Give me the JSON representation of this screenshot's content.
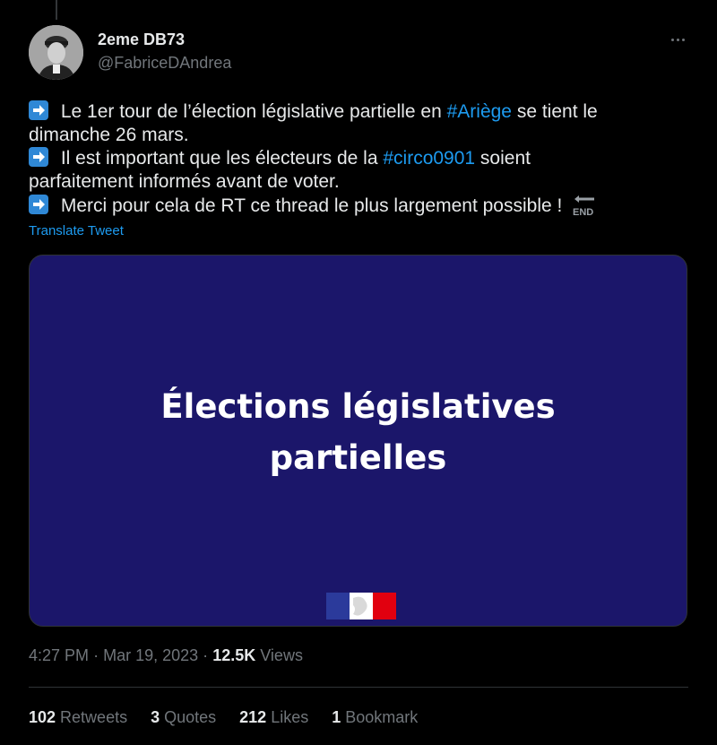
{
  "author": {
    "display_name": "2eme DB73",
    "handle": "@FabriceDAndrea"
  },
  "tweet": {
    "line1_a": " Le 1er tour de l’élection législative partielle en ",
    "line1_hashtag": "#Ariège",
    "line1_b": " se tient le",
    "line2": "dimanche 26 mars.",
    "line3_a": " Il est important que les électeurs de la ",
    "line3_hashtag": "#circo0901",
    "line3_b": " soient",
    "line4": "parfaitement informés avant de voter.",
    "line5": " Merci pour cela de RT ce thread le plus largement possible !",
    "end_emoji_text": "END",
    "translate_label": "Translate Tweet"
  },
  "media": {
    "title_line1": "Élections législatives",
    "title_line2": "partielles"
  },
  "meta": {
    "time": "4:27 PM",
    "separator": "·",
    "date": "Mar 19, 2023",
    "views_count": "12.5K",
    "views_label": "Views"
  },
  "stats": {
    "retweets_count": "102",
    "retweets_label": "Retweets",
    "quotes_count": "3",
    "quotes_label": "Quotes",
    "likes_count": "212",
    "likes_label": "Likes",
    "bookmarks_count": "1",
    "bookmarks_label": "Bookmark"
  },
  "icons": {
    "more": "more-options-icon",
    "arrow": "right-arrow-emoji",
    "end": "end-arrow-emoji",
    "flag": "marianne-tricolor-logo"
  },
  "colors": {
    "background": "#000000",
    "link": "#1d9bf0",
    "media_bg": "#1b166a",
    "muted": "#71767b"
  }
}
